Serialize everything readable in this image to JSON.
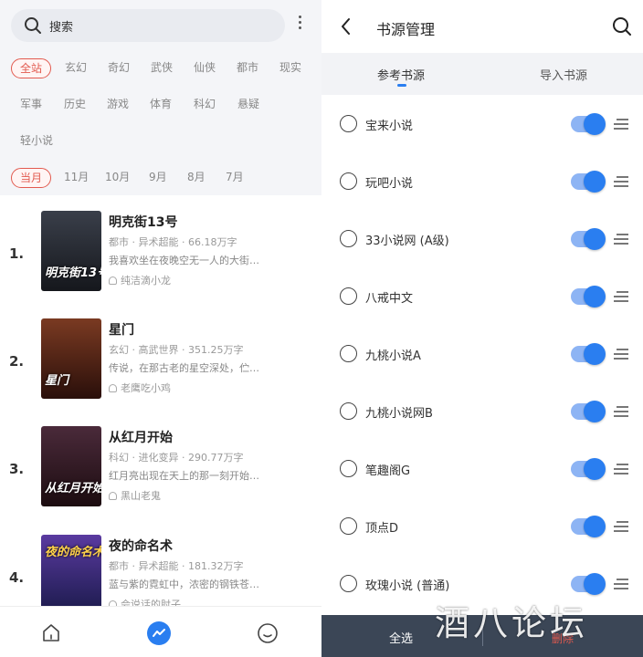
{
  "left": {
    "search": {
      "placeholder": "搜索"
    },
    "categories": [
      "全站",
      "玄幻",
      "奇幻",
      "武侠",
      "仙侠",
      "都市",
      "现实",
      "军事",
      "历史",
      "游戏",
      "体育",
      "科幻",
      "悬疑",
      "轻小说"
    ],
    "months": [
      "当月",
      "11月",
      "10月",
      "9月",
      "8月",
      "7月"
    ],
    "books": [
      {
        "rank": "1.",
        "title": "明克街13号",
        "meta": "都市 · 异术超能 · 66.18万字",
        "desc": "我喜欢坐在夜晚空无一人的大街…",
        "author": "纯洁滴小龙",
        "cover_text": "明克街13号",
        "cover_color": "#23262e"
      },
      {
        "rank": "2.",
        "title": "星门",
        "meta": "玄幻 · 高武世界 · 351.25万字",
        "desc": "传说，在那古老的星空深处，伫…",
        "author": "老鹰吃小鸡",
        "cover_text": "星门",
        "cover_color": "#5a2418"
      },
      {
        "rank": "3.",
        "title": "从红月开始",
        "meta": "科幻 · 进化变异 · 290.77万字",
        "desc": "红月亮出现在天上的那一刻开始…",
        "author": "黑山老鬼",
        "cover_text": "从红月开始",
        "cover_color": "#3a1a22"
      },
      {
        "rank": "4.",
        "title": "夜的命名术",
        "meta": "都市 · 异术超能 · 181.32万字",
        "desc": "蓝与紫的霓虹中，浓密的钢铁苍…",
        "author": "会说话的肘子",
        "cover_text": "夜的命名术",
        "cover_color": "#3a2a6a"
      }
    ]
  },
  "right": {
    "title": "书源管理",
    "tabs": [
      "参考书源",
      "导入书源"
    ],
    "sources": [
      {
        "name": "宝来小说",
        "enabled": true
      },
      {
        "name": "玩吧小说",
        "enabled": true
      },
      {
        "name": "33小说网 (A级)",
        "enabled": true
      },
      {
        "name": "八戒中文",
        "enabled": true
      },
      {
        "name": "九桃小说A",
        "enabled": true
      },
      {
        "name": "九桃小说网B",
        "enabled": true
      },
      {
        "name": "笔趣阁G",
        "enabled": true
      },
      {
        "name": "顶点D",
        "enabled": true
      },
      {
        "name": "玫瑰小说 (普通)",
        "enabled": true
      }
    ],
    "bottom": {
      "select_all": "全选",
      "delete": "删除"
    }
  },
  "watermark": "酒八论坛",
  "colors": {
    "accent": "#2a7ef0",
    "active_red": "#e25a4f",
    "bottom_bar": "#3b4656"
  }
}
